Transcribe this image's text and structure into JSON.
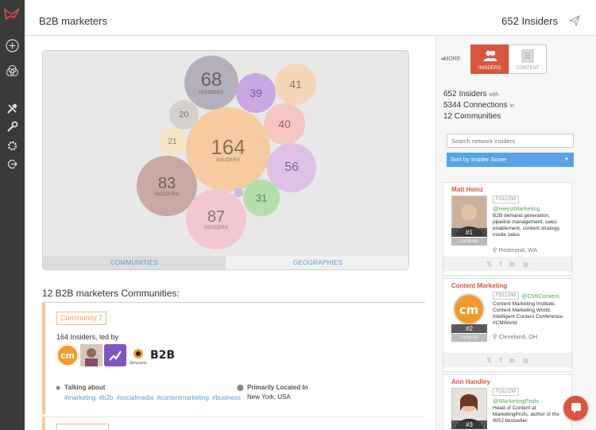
{
  "header": {
    "title": "B2B marketers",
    "count": "652 Insiders"
  },
  "bubbles": [
    {
      "value": "68",
      "sub": "INSIDERS",
      "color": "#b5aebb"
    },
    {
      "value": "39",
      "sub": "",
      "color": "#c9a7e0"
    },
    {
      "value": "41",
      "sub": "",
      "color": "#f6d4b6"
    },
    {
      "value": "20",
      "sub": "",
      "color": "#d3cfcb"
    },
    {
      "value": "40",
      "sub": "",
      "color": "#f5c6c2"
    },
    {
      "value": "21",
      "sub": "",
      "color": "#f3e7c8"
    },
    {
      "value": "164",
      "sub": "INSIDERS",
      "color": "#f6cba2"
    },
    {
      "value": "56",
      "sub": "",
      "color": "#ddc2e5"
    },
    {
      "value": "83",
      "sub": "INSIDERS",
      "color": "#c9a9a4"
    },
    {
      "value": "31",
      "sub": "",
      "color": "#b4dfab"
    },
    {
      "value": "87",
      "sub": "INSIDERS",
      "color": "#f4c7d0"
    },
    {
      "value": "",
      "sub": "",
      "color": "#cbbddd"
    }
  ],
  "bubble_tabs": {
    "communities": "COMMUNITIES",
    "geographies": "GEOGRAPHIES"
  },
  "communities": {
    "heading": "12 B2B marketers Communities:",
    "card": {
      "tag": "Community 7",
      "led_by": "164 Insiders, led by",
      "logo_text": "B2B",
      "talking_label": "Talking about",
      "tags": [
        "#marketing",
        "#b2b",
        "#socialmedia",
        "#contentmarketing",
        "#business"
      ],
      "location_label": "Primarily Located In",
      "location": "New York, USA"
    }
  },
  "right": {
    "more": "MORE",
    "tab_insiders": "INSIDERS",
    "tab_content": "CONTENT",
    "stats": {
      "insiders": "652 Insiders",
      "with": "with",
      "connections": "5344 Connections",
      "in": "in",
      "communities": "12 Communities"
    },
    "search_placeholder": "Search network insiders",
    "sort_label": "Sort by Insider Score",
    "people": [
      {
        "name": "Matt Heinz",
        "rank": "#1",
        "compare": "compare",
        "follow": "FOLLOW",
        "handle": "@HeinzMarketing",
        "bio": "B2B demand generation, pipeline management, sales enablement, content strategy, inside sales",
        "location": "Redmond, WA",
        "social": "𝕏 f in ◎"
      },
      {
        "name": "Content Marketing",
        "rank": "#2",
        "compare": "compare",
        "follow": "FOLLOW",
        "handle": "@CMIContent",
        "bio": "Content Marketing Institute. Content Marketing World. Intelligent Content Conference. #CMWorld",
        "location": "Cleveland, OH",
        "social": "𝕏 f in ◎"
      },
      {
        "name": "Ann Handley",
        "rank": "#3",
        "compare": "compare",
        "follow": "FOLLOW",
        "handle": "@MarketingProfs",
        "bio": "Head of Content at MarketingProfs, author of the WSJ bestseller,",
        "location": "",
        "social": ""
      }
    ]
  },
  "help": "?"
}
